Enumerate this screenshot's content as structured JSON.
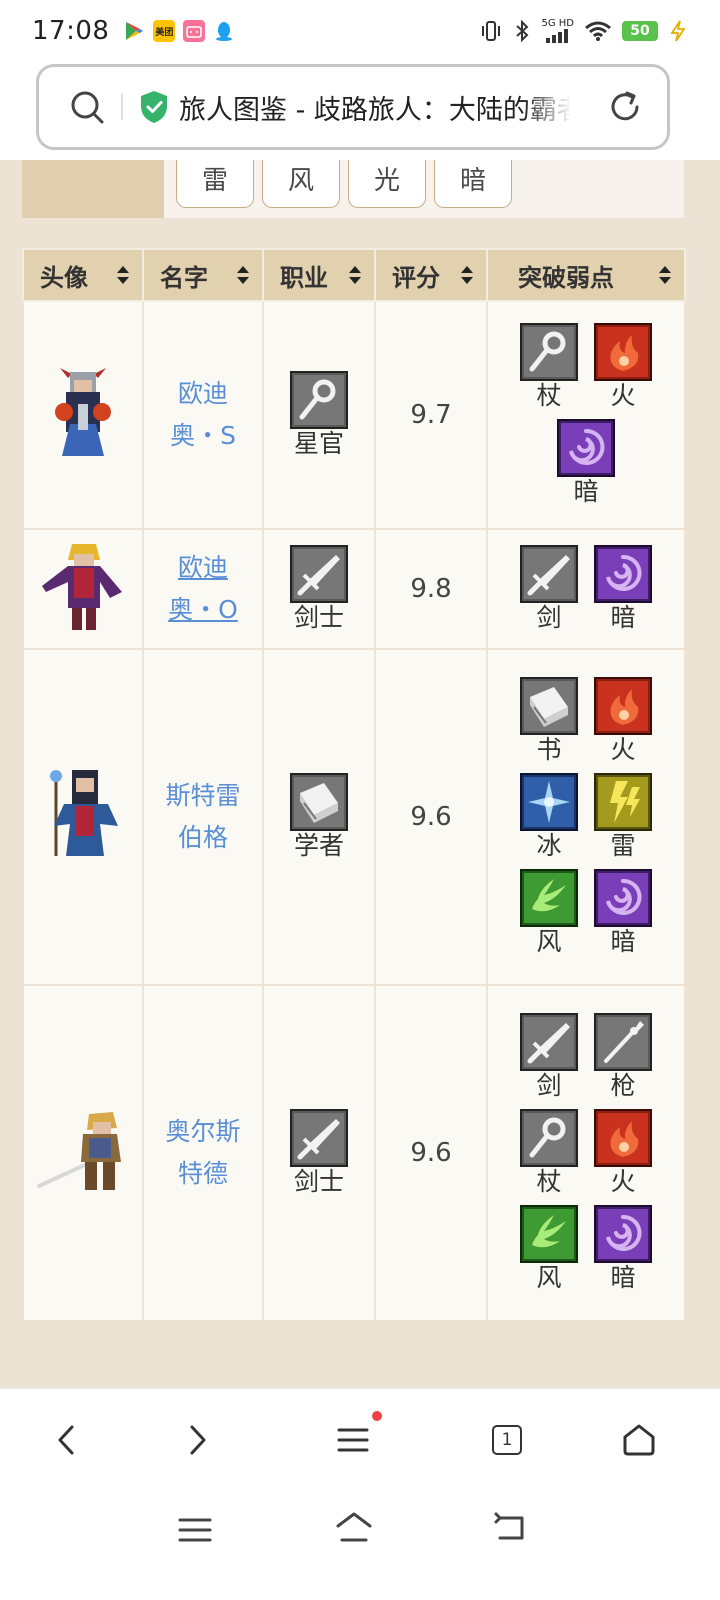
{
  "status_bar": {
    "time": "17:08",
    "notifications": [
      {
        "name": "google-play-icon",
        "color": "#ffffff"
      },
      {
        "name": "meituan-icon",
        "color": "#ffc300",
        "text": "美团"
      },
      {
        "name": "bilibili-icon",
        "color": "#fb7299"
      },
      {
        "name": "qq-icon",
        "color": "#1ea0f0"
      }
    ],
    "network": "5G HD",
    "battery": "50"
  },
  "browser": {
    "page_title": "旅人图鉴 - 歧路旅人：大陆的霸者",
    "tabs_count": "1"
  },
  "filter": {
    "elements": [
      "雷",
      "风",
      "光",
      "暗"
    ]
  },
  "table": {
    "headers": [
      "头像",
      "名字",
      "职业",
      "评分",
      "突破弱点"
    ],
    "rows": [
      {
        "name_line1": "欧迪",
        "name_line2": "奥・S",
        "job": "星官",
        "job_icon": "staff",
        "score": "9.7",
        "weaknesses": [
          {
            "label": "杖",
            "icon": "staff"
          },
          {
            "label": "火",
            "icon": "fire"
          },
          {
            "label": "暗",
            "icon": "dark"
          }
        ]
      },
      {
        "name_line1": "欧迪",
        "name_line2": "奥・O",
        "job": "剑士",
        "job_icon": "sword",
        "score": "9.8",
        "weaknesses": [
          {
            "label": "剑",
            "icon": "sword"
          },
          {
            "label": "暗",
            "icon": "dark"
          }
        ]
      },
      {
        "name_line1": "斯特雷",
        "name_line2": "伯格",
        "job": "学者",
        "job_icon": "book",
        "score": "9.6",
        "weaknesses": [
          {
            "label": "书",
            "icon": "book"
          },
          {
            "label": "火",
            "icon": "fire"
          },
          {
            "label": "冰",
            "icon": "ice"
          },
          {
            "label": "雷",
            "icon": "thunder"
          },
          {
            "label": "风",
            "icon": "wind"
          },
          {
            "label": "暗",
            "icon": "dark"
          }
        ]
      },
      {
        "name_line1": "奥尔斯",
        "name_line2": "特德",
        "job": "剑士",
        "job_icon": "sword",
        "score": "9.6",
        "weaknesses": [
          {
            "label": "剑",
            "icon": "sword"
          },
          {
            "label": "枪",
            "icon": "spear"
          },
          {
            "label": "杖",
            "icon": "staff"
          },
          {
            "label": "火",
            "icon": "fire"
          },
          {
            "label": "风",
            "icon": "wind"
          },
          {
            "label": "暗",
            "icon": "dark"
          }
        ]
      }
    ]
  },
  "colors": {
    "link": "#5a8fd6",
    "header_bg": "#e1d1af",
    "page_bg": "#ece3d4",
    "fire": "#c8321e",
    "dark": "#7a3fb8",
    "ice": "#2f5fa8",
    "thunder": "#a49a1e",
    "wind": "#3e9a32",
    "weapon": "#5a5a5a"
  }
}
